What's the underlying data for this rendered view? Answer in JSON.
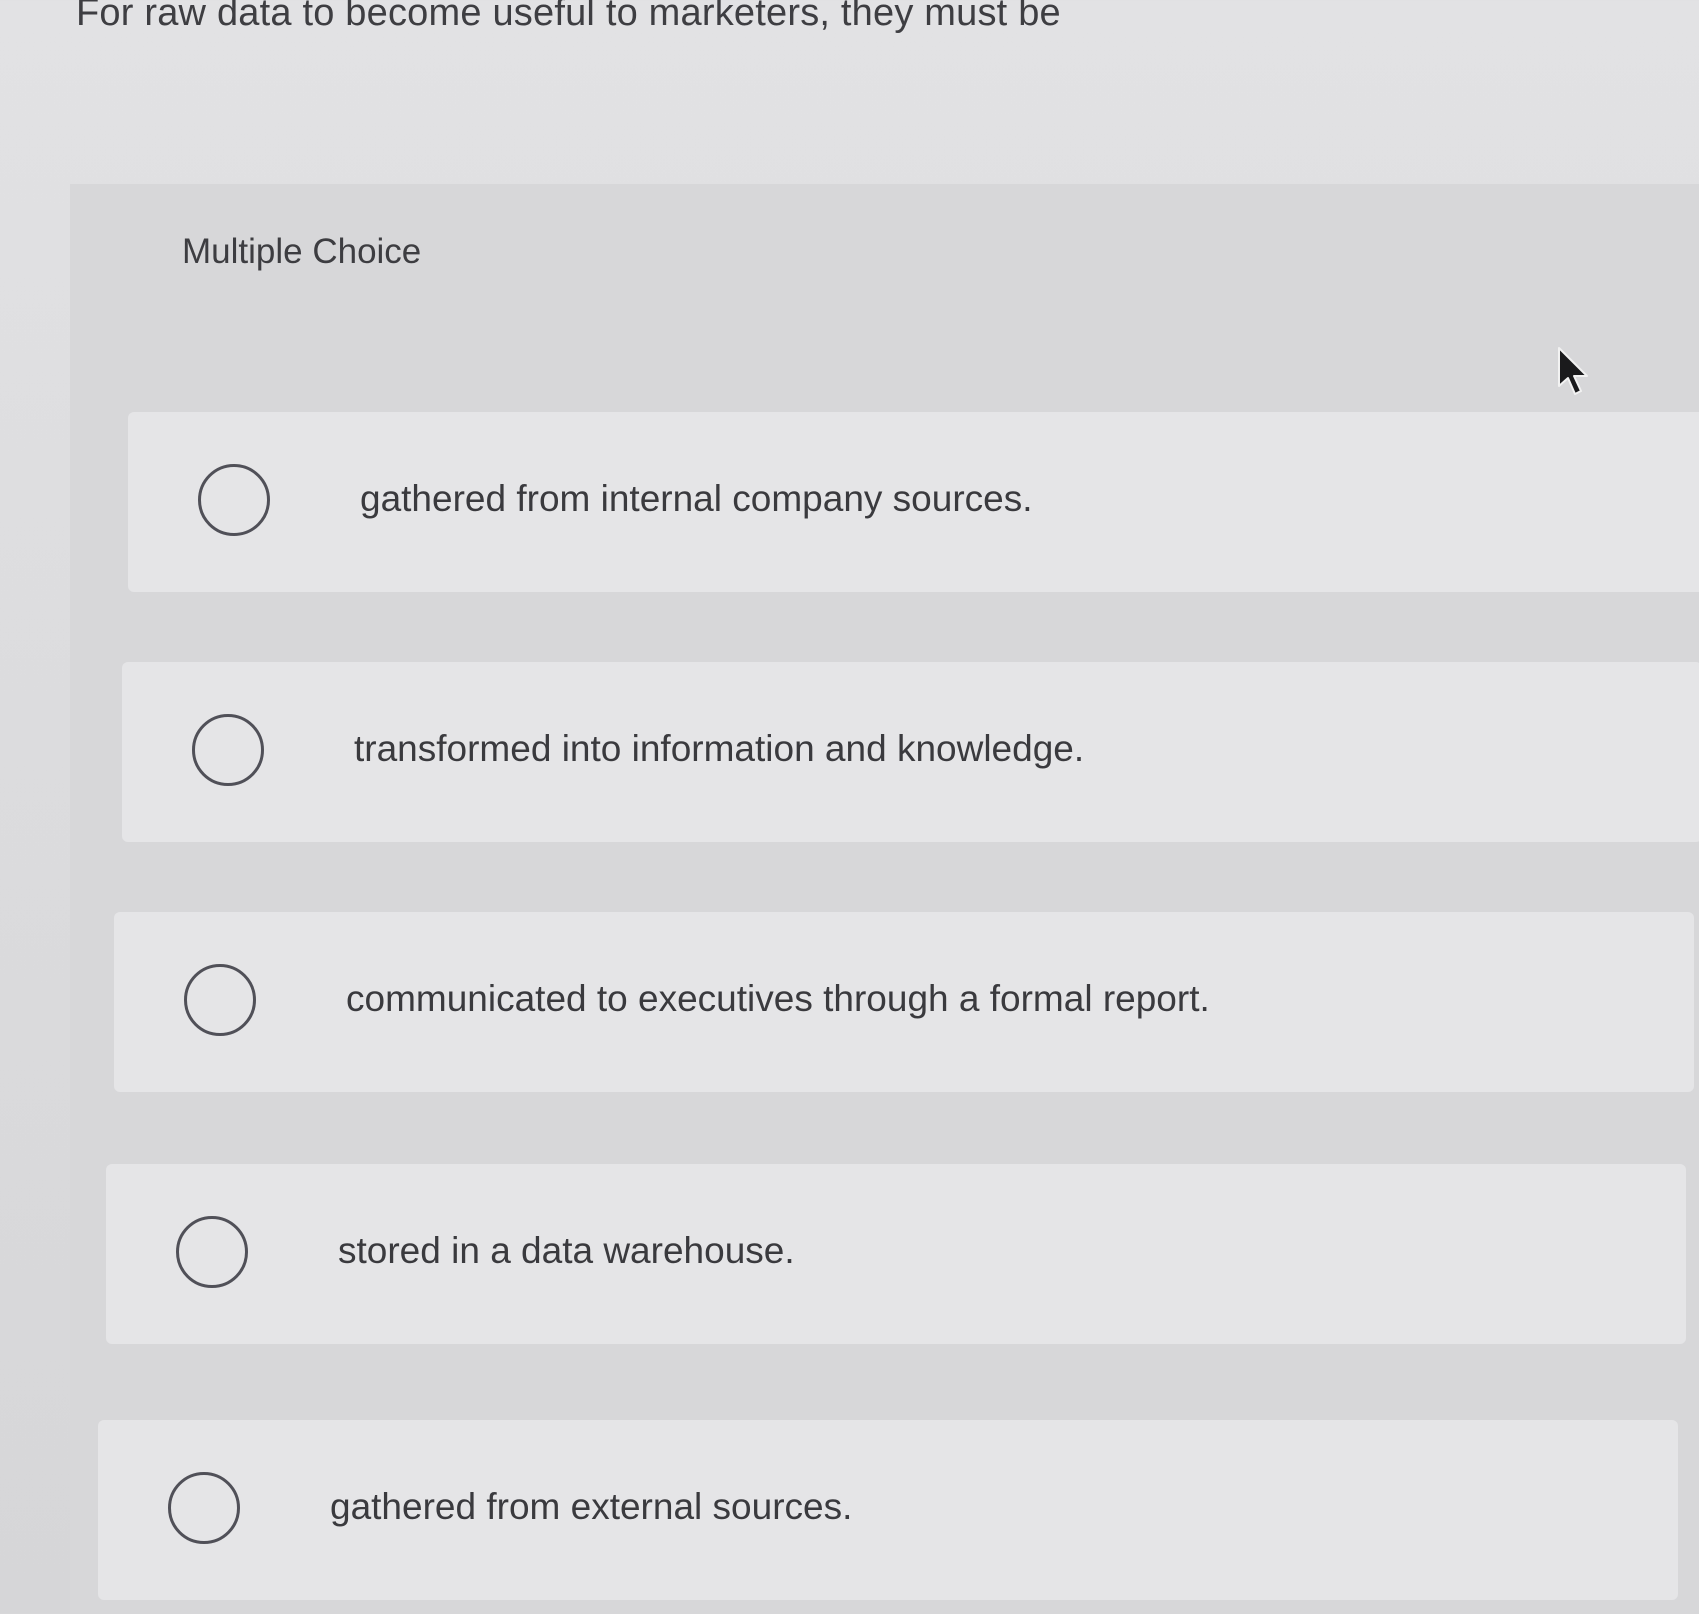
{
  "question": {
    "text": "For raw data to become useful to marketers, they must be"
  },
  "section": {
    "label": "Multiple Choice"
  },
  "options": [
    {
      "text": "gathered from internal company sources."
    },
    {
      "text": "transformed into information and knowledge."
    },
    {
      "text": "communicated to executives through a formal report."
    },
    {
      "text": "stored in a data warehouse."
    },
    {
      "text": "gathered from external sources."
    }
  ],
  "cursor": {
    "icon": "arrow-pointer-icon"
  }
}
